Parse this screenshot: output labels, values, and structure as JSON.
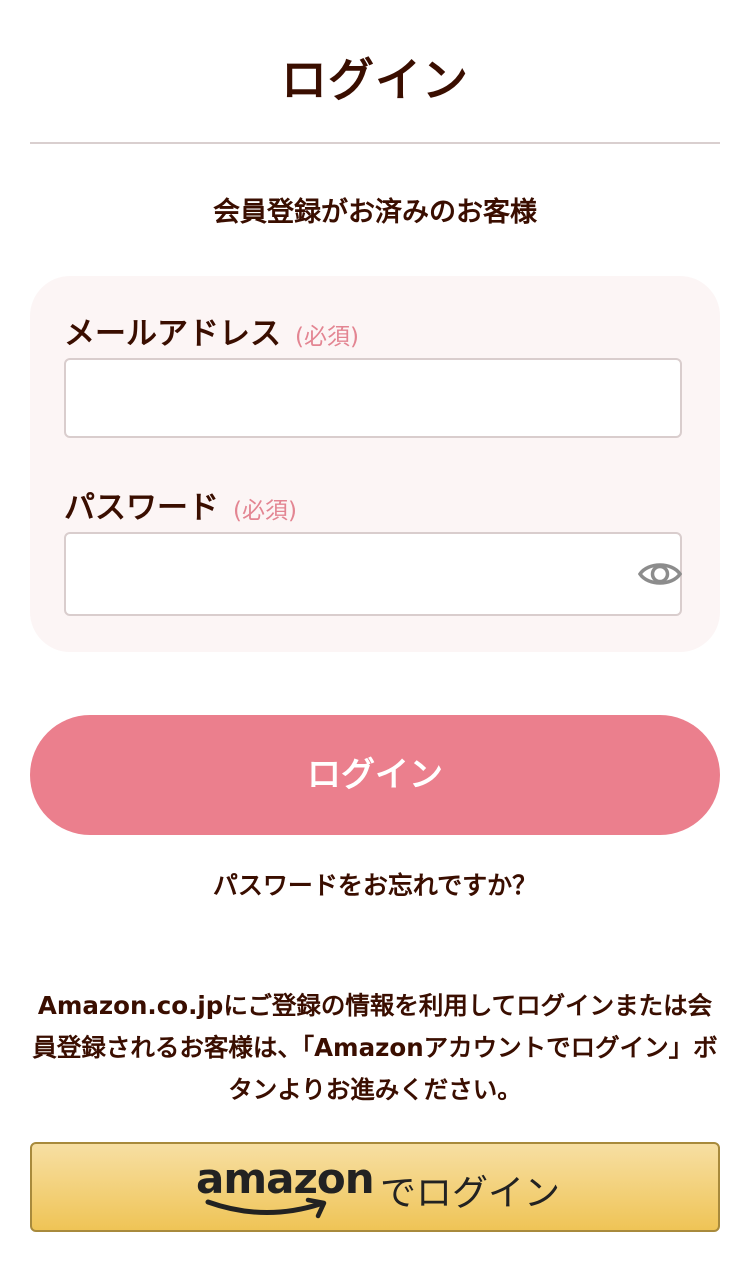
{
  "header": {
    "title": "ログイン"
  },
  "login_section": {
    "title": "会員登録がお済みのお客様",
    "email": {
      "label": "メールアドレス",
      "required": "(必須)",
      "value": ""
    },
    "password": {
      "label": "パスワード",
      "required": "(必須)",
      "value": "",
      "toggle_icon": "eye-icon"
    },
    "submit_label": "ログイン",
    "forgot_link": "パスワードをお忘れですか？"
  },
  "amazon_section": {
    "note": "Amazon.co.jpにご登録の情報を利用してログインまたは会員登録されるお客様は、「Amazonアカウントでログイン」ボタンよりお進みください。",
    "logo_text": "amazon",
    "button_label": "でログイン"
  },
  "colors": {
    "text": "#3a0e00",
    "accent_pink": "#eb7f8d",
    "required_pink": "#e38592",
    "card_bg": "#fcf5f5",
    "amazon_gold": "#efc456"
  }
}
